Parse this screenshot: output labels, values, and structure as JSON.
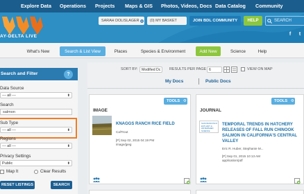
{
  "top_nav": {
    "items": [
      "Explore Data",
      "Operations",
      "Projects",
      "Maps & GIS",
      "Photos, Videos, Docs",
      "Data Catalog",
      "Community"
    ]
  },
  "header": {
    "logo_text": "AY-DELTA LIVE",
    "user_label": "SARAH DOLISLAGER",
    "basket_label": "(0) MY BASKET",
    "join_label": "JOIN BDL COMMUNITY",
    "help_label": "HELP",
    "search_placeholder": "SEARCH",
    "social": [
      "f",
      "t"
    ]
  },
  "tabs": {
    "items": [
      "What's New",
      "Search & List View",
      "Places",
      "Species & Environment",
      "Add New",
      "Science",
      "Help"
    ],
    "active": "Search & List View"
  },
  "filter_panel": {
    "title": "Search and Filter",
    "help_icon": "?",
    "data_source_label": "Data Source",
    "data_source_value": "--- all ---",
    "search_label": "Search",
    "search_value": "salmon",
    "sub_type_label": "Sub Type",
    "sub_type_value": "--- all ---",
    "regions_label": "Regions",
    "regions_value": "--- all ---",
    "privacy_label": "Privacy Settings",
    "privacy_value": "Public",
    "map_it_label": "Map It",
    "clear_results_label": "Clear Results",
    "reset_label": "RESET LISTINGS",
    "search_button": "SEARCH",
    "highlight_color": "#f07c22"
  },
  "results": {
    "sort_by_label": "SORT BY:",
    "sort_value": "Modified Dc",
    "per_page_label": "RESULTS PER PAGE",
    "per_page_value": "6",
    "view_on_map_label": "VIEW ON MAP",
    "my_docs": "My Docs",
    "public_docs": "Public Docs",
    "cards": [
      {
        "tools": "TOOLS",
        "type": "IMAGE",
        "title": "KNAGGS RANCH RICE FIELD",
        "author": "CalTrout",
        "date": "[P] Sep 02, 2015 04:19 PM",
        "mime": "image/jpeg"
      },
      {
        "tools": "TOOLS",
        "type": "JOURNAL",
        "title": "TEMPORAL TRENDS IN HATCHERY RELEASES OF FALL RUN CHINOOK SALMON IN CALIFORNIA'S CENTRAL VALLEY",
        "thumb_text": "SAN FRANCISCO ESTUARY & WATERSHED SCIENCE",
        "author": "Eric R. Huber, Stephanie M...",
        "date": "[P] Sep 01, 2015 10:13 AM",
        "mime": "application/pdf"
      }
    ]
  },
  "colors": {
    "nav": "#1b5d8c",
    "header": "#2d8fc4",
    "accent_blue": "#5aaee0",
    "accent_green": "#8dc63f",
    "dark_button": "#1d5f93"
  }
}
